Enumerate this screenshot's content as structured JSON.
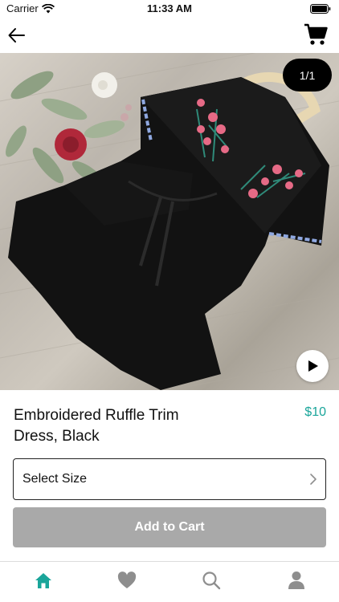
{
  "status_bar": {
    "carrier": "Carrier",
    "time": "11:33 AM"
  },
  "nav": {
    "back_icon": "arrow-left-icon",
    "cart_icon": "shopping-cart-icon"
  },
  "gallery": {
    "page_indicator": "1/1",
    "play_icon": "play-icon"
  },
  "product": {
    "title": "Embroidered Ruffle Trim Dress, Black",
    "price": "$10"
  },
  "size_select": {
    "label": "Select Size"
  },
  "add_to_cart": {
    "label": "Add to Cart"
  },
  "tab_bar": {
    "items": [
      {
        "icon": "home-icon",
        "active": true
      },
      {
        "icon": "heart-icon",
        "active": false
      },
      {
        "icon": "search-icon",
        "active": false
      },
      {
        "icon": "profile-icon",
        "active": false
      }
    ]
  },
  "colors": {
    "accent": "#1aa59a",
    "button_disabled": "#a9a9a9",
    "inactive_icon": "#8e8e8e"
  }
}
